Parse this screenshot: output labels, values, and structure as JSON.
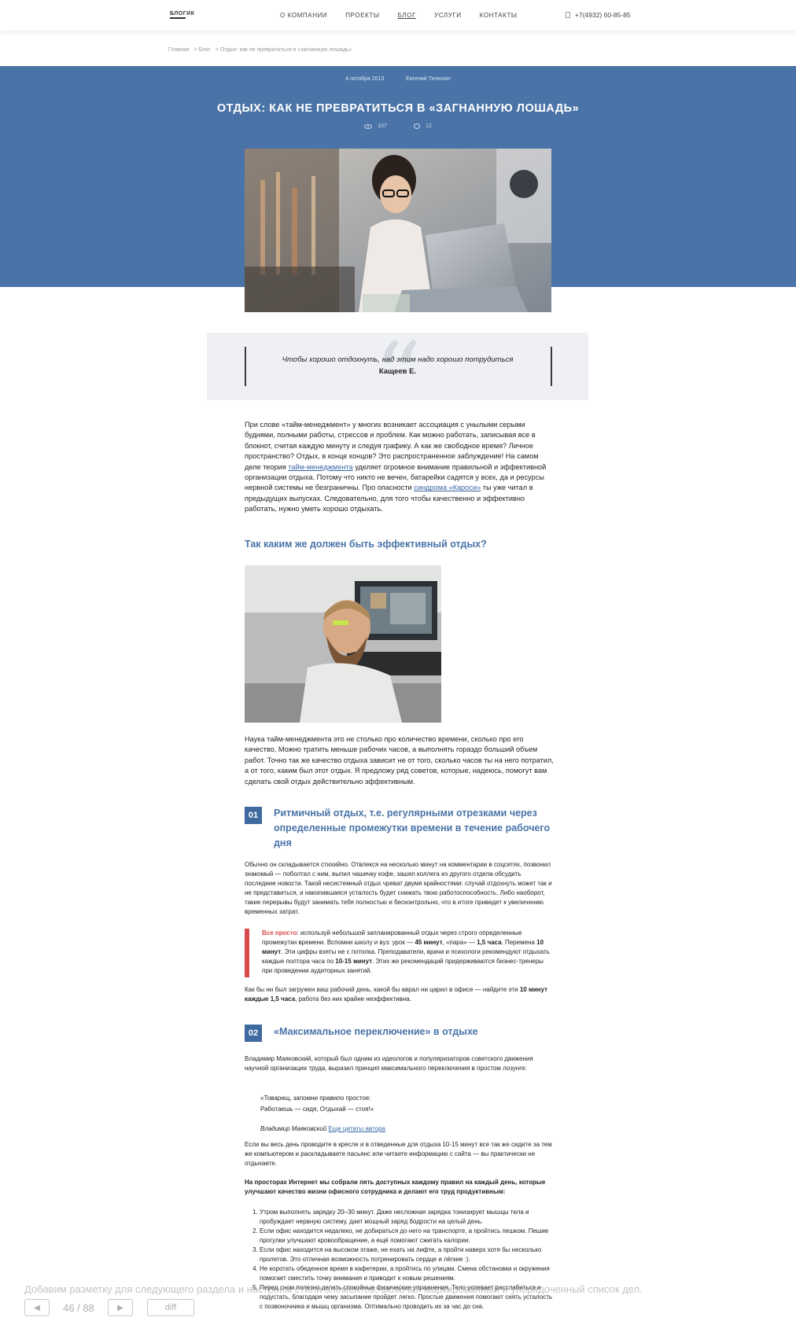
{
  "header": {
    "logo": "БЛОГИК",
    "nav": [
      "О КОМПАНИИ",
      "ПРОЕКТЫ",
      "БЛОГ",
      "УСЛУГИ",
      "КОНТАКТЫ"
    ],
    "phone": "+7(4932) 60-85-85"
  },
  "breadcrumb": [
    "Главная",
    "> Блог",
    "> Отдых: как не превратиться в «загнанную лошадь»"
  ],
  "post": {
    "date": "4 октября 2013",
    "author": "Евгений Телюхин",
    "title": "ОТДЫХ: КАК НЕ ПРЕВРАТИТЬСЯ В «ЗАГНАННУЮ ЛОШАДЬ»",
    "views": "107",
    "comments": "12"
  },
  "quote": {
    "text": "Чтобы хорошо отдохнуть, над этим надо хорошо потрудиться",
    "author": "Кащеев Е."
  },
  "article": {
    "p1_a": "При слове «тайм-менеджмент» у многих возникает ассоциация с унылыми серыми буднями, полными работы, стрессов и проблем. Как можно работать, записывая все в блокнот, считая каждую минуту и следуя графику. А как же свободное время? Личное пространство? Отдых, в конце концов? Это распространенное заблуждение! На самом деле теория ",
    "p1_link1": "тайм-менеджмента",
    "p1_b": " уделяет огромное внимание правильной и эффективной организации отдыха. Потому что никто не вечен, батарейки садятся у всех, да и ресурсы нервной системы не безграничны. Про опасности ",
    "p1_link2": "синдрома «Кароси»",
    "p1_c": " ты уже читал в предыдущих выпусках. Следовательно, для того чтобы качественно и эффективно работать, нужно уметь хорошо отдыхать.",
    "h2": "Так каким же должен быть эффективный отдых?",
    "p2": "Наука тайм-менеджмента это не столько про количество времени, сколько про его качество. Можно тратить меньше рабочих часов, а выполнять гораздо больший объем работ. Точно так же качество отдыха зависит не от того, сколько часов ты на него потратил, а от того, каким был этот отдых. Я предложу ряд советов, которые, надеюсь, помогут вам сделать свой отдых действительно эффективным.",
    "s1_num": "01",
    "s1_title": "Ритмичный отдых, т.е. регулярными отрезками через определенные промежутки времени в течение рабочего дня",
    "s1_p": "Обычно он складывается стихийно. Отвлекся на несколько минут на комментарии в соцсетях, позвонил знакомый — поболтал с ним, выпил чашечку кофе, зашел коллега из другого отдела обсудить последние новости. Такой несистемный отдых чреват двумя крайностями: случай отдохнуть может так и не представиться, и накопившаяся усталость будет снижать твою работоспособность. Либо наоборот, такие перерывы будут занимать тебя полностью и бесконтрольно, что в итоге приведет к увеличению временных затрат.",
    "callout_label": "Все просто",
    "callout_1": ": используй небольшой запланированный отдых через строго определенные промежутки времени. Вспомни школу и вуз: урок — ",
    "callout_b1": "45 минут",
    "callout_2": ", «пара» — ",
    "callout_b2": "1,5 часа",
    "callout_3": ". Перемена ",
    "callout_b3": "10 минут",
    "callout_4": ". Эти цифры взяты не с потолка. Преподаватели, врачи и психологи рекомендуют отдыхать каждые полтора часа по ",
    "callout_b4": "10-15 минут",
    "callout_5": ". Этих же рекомендаций придерживаются бизнес-тренеры при проведении аудиторных занятий.",
    "s1_after_1": "Как бы ни был загружен ваш рабочий день, какой бы аврал ни царил в офисе — найдите эти ",
    "s1_after_b": "10 минут каждые 1,5 часа",
    "s1_after_2": ", работа без них крайне неэффективна.",
    "s2_num": "02",
    "s2_title": "«Максимальное переключение» в отдыхе",
    "s2_p": "Владимир Маяковский, который был одним из идеологов и популяризаторов советского движения научной организации труда, выразил принцип максимального переключения в простом лозунге:",
    "lozung_1": "«Товарищ, запомни правило простое:",
    "lozung_2": "Работаешь — сидя, Отдыхай — стоя!»",
    "sign_name": "Владимир Маяковский",
    "sign_link": "Еще цитаты автора",
    "s2_p2": "Если вы весь день проводите в кресле и в отведенные для отдыха 10-15 минут все так же сидите за тем же компьютером и раскладываете пасьянс или читаете информацию с сайта — вы практически не отдыхаете.",
    "bold_p": "На просторах Интернет мы собрали пять доступных каждому правил на каждый день, которые улучшают качество жизни офисного сотрудника и делают его труд продуктивным:",
    "list": [
      "Утром выполнять зарядку 20–30 минут. Даже несложная зарядка тонизирует мышцы тела и пробуждает нервную систему, дает мощный заряд бодрости на целый день.",
      "Если офис находится недалеко, не добираться до него на транспорте, а пройтись пешком. Пешие прогулки улучшают кровообращение, а ещё помогают сжигать калории.",
      "Если офис находится на высоком этаже, не ехать на лифте, а пройти наверх хотя бы несколько пролетов. Это отличная возможность потренировать сердце и лёгкие :).",
      "Не коротать обеденное время в кафетерии, а пройтись по улицам. Смена обстановки и окружения помогает сместить точку внимания и приводит к новым решениям.",
      "Перед сном полезно делать спокойные физические упражнения. Тело успевает расслабиться и подустать, благодаря чему засыпание пройдет легко. Простые движения помогают снять усталость с позвоночника и мышц организма. Оптимально проводить их за час до сна."
    ]
  },
  "overlay": {
    "caption": "Добавим разметку для следующего раздела и настроим стили элементов, включая маркированный и упорядоченный список дел.",
    "counter": "46 / 88",
    "diff": "diff"
  }
}
